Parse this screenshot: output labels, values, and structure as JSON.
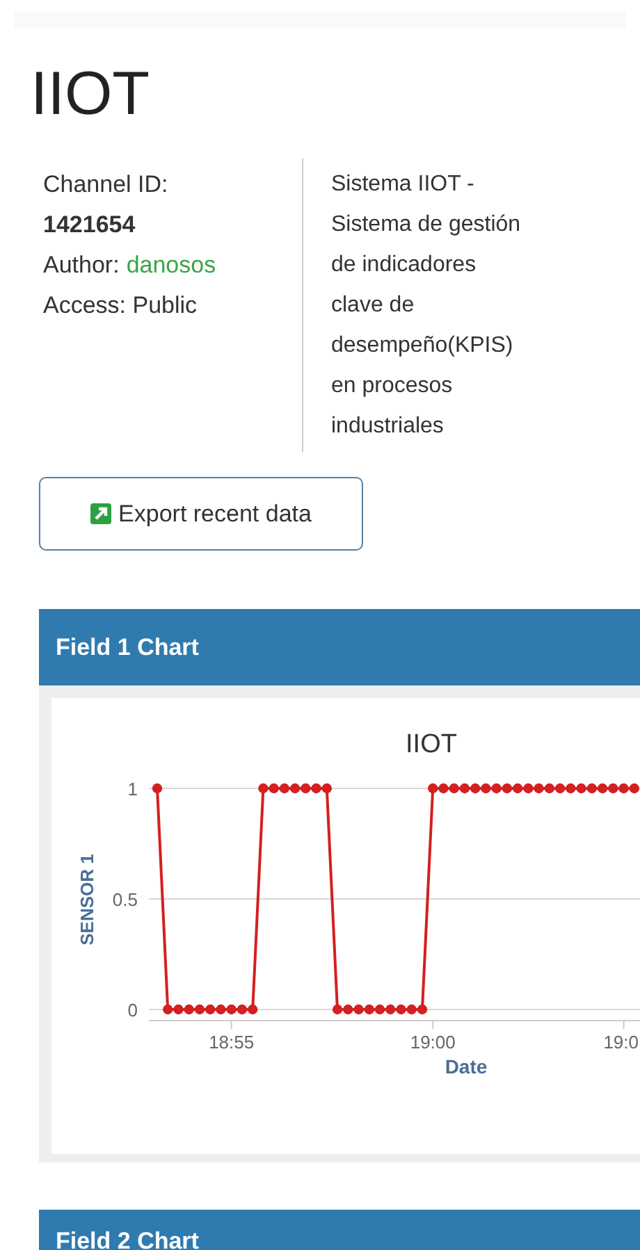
{
  "channel": {
    "title": "IIOT",
    "id_label": "Channel ID:",
    "id": "1421654",
    "author_label": "Author:",
    "author": "danosos",
    "access": "Access: Public",
    "description": "Sistema IIOT - Sistema de gestión de indicadores clave de desempeño(KPIS) en procesos industriales"
  },
  "export_button": "Export recent data",
  "panels": [
    {
      "title": "Field 1 Chart",
      "chart_data": {
        "type": "line",
        "title": "IIOT",
        "xlabel": "Date",
        "ylabel": "SENSOR 1",
        "categories": [
          null,
          null,
          null,
          null,
          null,
          null,
          null,
          "18:55",
          null,
          null,
          null,
          null,
          null,
          null,
          null,
          null,
          null,
          null,
          null,
          null,
          null,
          null,
          null,
          null,
          null,
          null,
          "19:00",
          null,
          null,
          null,
          null,
          null,
          null,
          null,
          null,
          null,
          null,
          null,
          null,
          null,
          null,
          null,
          null,
          null,
          "19:0",
          null
        ],
        "series": [
          {
            "color": "#d42020",
            "marker": "circle",
            "values": [
              1,
              0,
              0,
              0,
              0,
              0,
              0,
              0,
              0,
              0,
              1,
              1,
              1,
              1,
              1,
              1,
              1,
              0,
              0,
              0,
              0,
              0,
              0,
              0,
              0,
              0,
              1,
              1,
              1,
              1,
              1,
              1,
              1,
              1,
              1,
              1,
              1,
              1,
              1,
              1,
              1,
              1,
              1,
              1,
              1,
              1
            ]
          }
        ],
        "yticks": [
          0,
          0.5,
          1
        ],
        "ylim": [
          0,
          1
        ]
      }
    },
    {
      "title": "Field 2 Chart"
    }
  ]
}
